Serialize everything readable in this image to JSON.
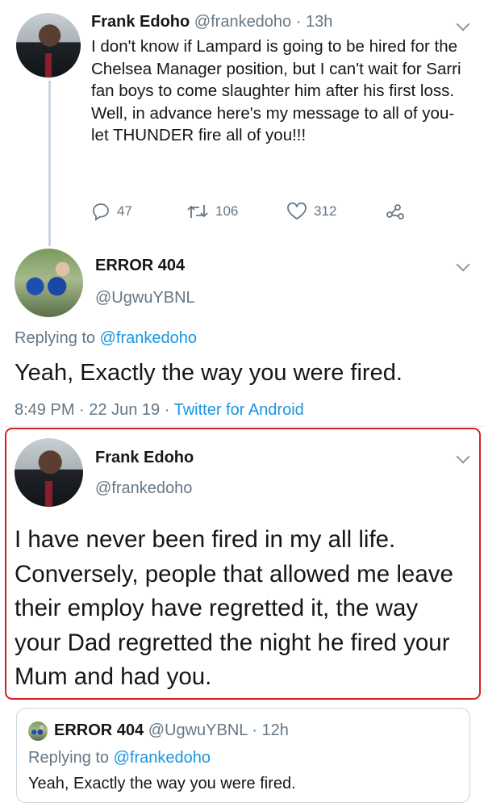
{
  "tweet1": {
    "name": "Frank Edoho",
    "handle": "@frankedoho",
    "time": "13h",
    "text": "I don't know if Lampard is going to be hired for the Chelsea Manager position, but I can't wait for Sarri fan boys to come slaughter him after his first loss. Well, in advance here's my message to all of you-let THUNDER fire all of you!!!",
    "replies": "47",
    "retweets": "106",
    "likes": "312"
  },
  "tweet2": {
    "name": "ERROR 404",
    "handle": "@UgwuYBNL",
    "replying_prefix": "Replying to",
    "replying_to": "@frankedoho",
    "text": "Yeah, Exactly the way you were fired.",
    "time": "8:49 PM",
    "date": "22 Jun 19",
    "client": "Twitter for Android"
  },
  "tweet3": {
    "name": "Frank Edoho",
    "handle": "@frankedoho",
    "text": "I have never been fired in my all life. Conversely, people that allowed me leave their employ have regretted it, the way your Dad regretted the night he fired your Mum and had you."
  },
  "quote": {
    "name": "ERROR 404",
    "handle": "@UgwuYBNL",
    "time": "12h",
    "replying_prefix": "Replying to",
    "replying_to": "@frankedoho",
    "text": "Yeah, Exactly the way you were fired."
  },
  "colors": {
    "link": "#1b95e0",
    "muted": "#657786",
    "highlight_border": "#d21f26",
    "divider": "#e6ecf0"
  },
  "icons": [
    "chevron-down-icon",
    "reply-icon",
    "retweet-icon",
    "like-icon",
    "share-icon"
  ]
}
